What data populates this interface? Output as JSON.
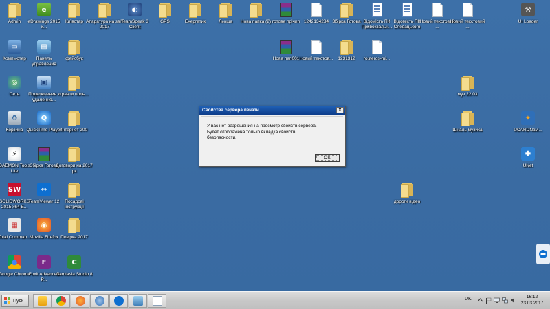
{
  "desktop": {
    "icons": [
      {
        "label": "Admin",
        "kind": "folder"
      },
      {
        "label": "eDrawings 2015 x...",
        "kind": "edrawings"
      },
      {
        "label": "Київстар",
        "kind": "folder"
      },
      {
        "label": "Апаратура на звіт 2017",
        "kind": "folder"
      },
      {
        "label": "TeamSpeak 3 Client",
        "kind": "teamspeak"
      },
      {
        "label": "GPS",
        "kind": "folder"
      },
      {
        "label": "Енергетик",
        "kind": "folder"
      },
      {
        "label": "Льоша",
        "kind": "folder"
      },
      {
        "label": "Нова папка (2)",
        "kind": "folder"
      },
      {
        "label": "готове прічип",
        "kind": "rar"
      },
      {
        "label": "1242134234",
        "kind": "doc"
      },
      {
        "label": "Збірка Готова",
        "kind": "folder"
      },
      {
        "label": "Відомість ПК Привокзальн...",
        "kind": "bluedoc"
      },
      {
        "label": "Відомість ПК Словацького",
        "kind": "bluedoc"
      },
      {
        "label": "Новий текстовий ...",
        "kind": "doc"
      },
      {
        "label": "Новий текстовий ...",
        "kind": "doc"
      },
      {
        "label": "UI Loader",
        "kind": "uiloader"
      },
      {
        "label": "Компьютер",
        "kind": "computer"
      },
      {
        "label": "Панель управления",
        "kind": "controlpanel"
      },
      {
        "label": "фейсбук",
        "kind": "folder"
      },
      {
        "label": "Нова пап001",
        "kind": "rar"
      },
      {
        "label": "Новий текстов...",
        "kind": "doc"
      },
      {
        "label": "1231312",
        "kind": "folder"
      },
      {
        "label": "routeros-mi...",
        "kind": "doc"
      },
      {
        "label": "Сеть",
        "kind": "network"
      },
      {
        "label": "Подключение к удаленно...",
        "kind": "rdp"
      },
      {
        "label": "гранти поль...",
        "kind": "folder"
      },
      {
        "label": "муз 22.03",
        "kind": "folder"
      },
      {
        "label": "Корзина",
        "kind": "recycle"
      },
      {
        "label": "QuickTime Player",
        "kind": "quicktime"
      },
      {
        "label": "Інтернет 200",
        "kind": "folder"
      },
      {
        "label": "Шналь музика",
        "kind": "folder"
      },
      {
        "label": "UCARDNavi...",
        "kind": "ucard"
      },
      {
        "label": "DAEMON Tools Lite",
        "kind": "daemon"
      },
      {
        "label": "Збірка Готова",
        "kind": "rar"
      },
      {
        "label": "Договори на 2017 рк",
        "kind": "folder"
      },
      {
        "label": "UNet",
        "kind": "unet"
      },
      {
        "label": "дороги відео",
        "kind": "folder"
      },
      {
        "label": "SOLIDWORKS 2015 x64 E...",
        "kind": "solidworks"
      },
      {
        "label": "TeamViewer 12",
        "kind": "teamviewer"
      },
      {
        "label": "Посадові інструкції",
        "kind": "folder"
      },
      {
        "label": "Total Comman...",
        "kind": "totalcmd"
      },
      {
        "label": "Mozilla Firefox",
        "kind": "firefox"
      },
      {
        "label": "Повірка 2017",
        "kind": "folder"
      },
      {
        "label": "Google Chrome",
        "kind": "chrome"
      },
      {
        "label": "Foxit Advanced P...",
        "kind": "foxit"
      },
      {
        "label": "Camtasia Studio 8",
        "kind": "camtasia"
      }
    ]
  },
  "dialog": {
    "title": "Свойства сервера печати",
    "close_label": "x",
    "message_line1": "У вас нет разрешения на просмотр свойств сервера.",
    "message_line2": "Будет отображена только вкладка свойств",
    "message_line3": "безопасности.",
    "ok_label": "OK"
  },
  "taskbar": {
    "start_label": "Пуск",
    "pinned": [
      "player-icon",
      "chrome-icon",
      "firefox-icon",
      "thunderbird-icon",
      "teamviewer-icon",
      "control-panel-icon",
      "document-icon"
    ],
    "language": "UK",
    "time": "16:12",
    "date": "23.03.2017"
  },
  "colors": {
    "desktop": "#3a6ea5",
    "title_bar": "#1f5fb4"
  }
}
